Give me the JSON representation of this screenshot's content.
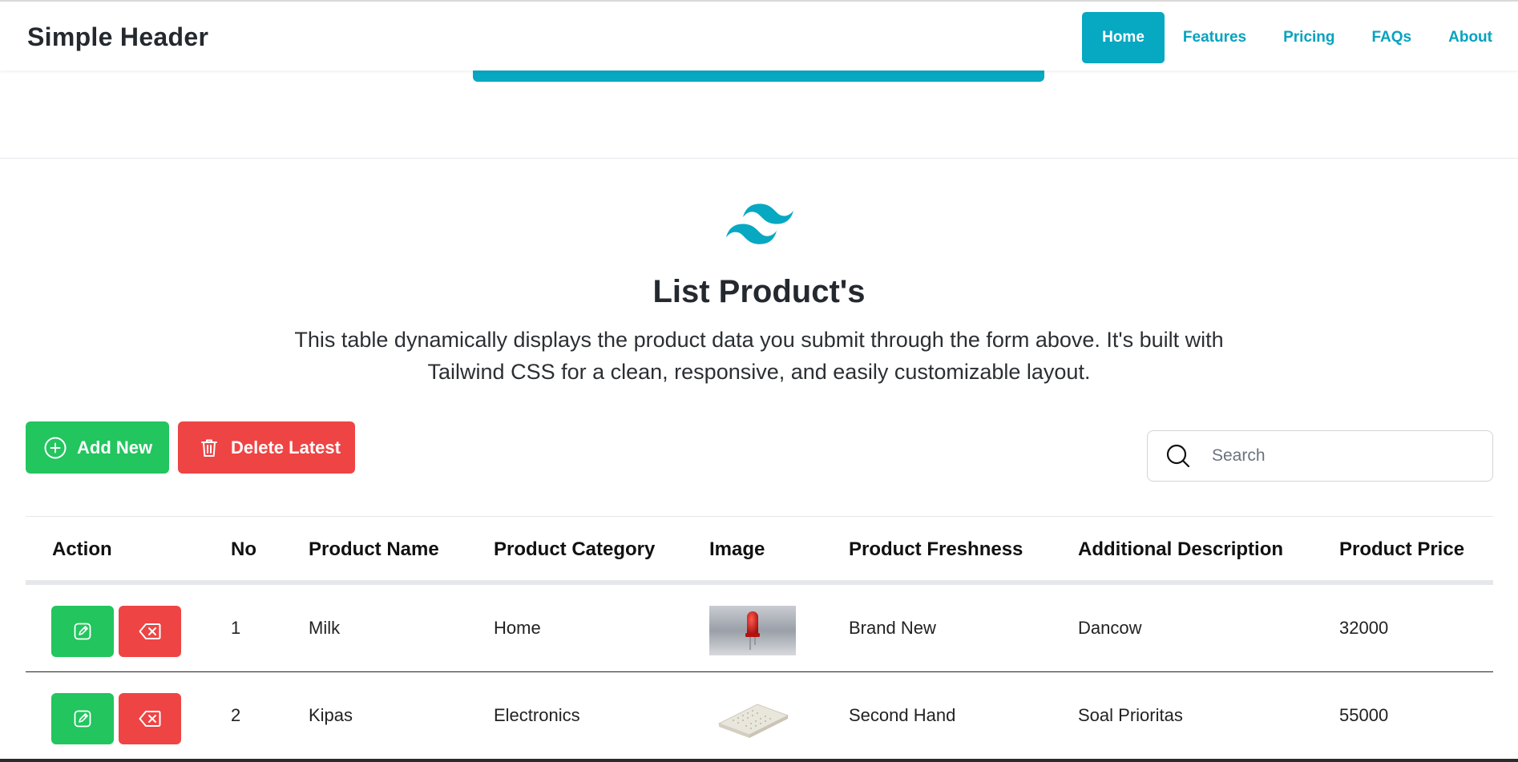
{
  "header": {
    "brand": "Simple Header",
    "nav": [
      "Home",
      "Features",
      "Pricing",
      "FAQs",
      "About"
    ],
    "active": "Home"
  },
  "section": {
    "title": "List Product's",
    "description_line1": "This table dynamically displays the product data you submit through the form above. It's built with",
    "description_line2": "Tailwind CSS for a clean, responsive, and easily customizable layout."
  },
  "toolbar": {
    "add_label": "Add New",
    "delete_label": "Delete Latest",
    "search_placeholder": "Search"
  },
  "table": {
    "headers": [
      "Action",
      "No",
      "Product Name",
      "Product Category",
      "Image",
      "Product Freshness",
      "Additional Description",
      "Product Price"
    ],
    "rows": [
      {
        "no": "1",
        "name": "Milk",
        "category": "Home",
        "image": "red-led-image",
        "freshness": "Brand New",
        "description": "Dancow",
        "price": "32000"
      },
      {
        "no": "2",
        "name": "Kipas",
        "category": "Electronics",
        "image": "breadboard-image",
        "freshness": "Second Hand",
        "description": "Soal Prioritas",
        "price": "55000"
      }
    ]
  },
  "colors": {
    "accent": "#06a8c2",
    "add": "#22c55e",
    "delete": "#ef4444"
  }
}
